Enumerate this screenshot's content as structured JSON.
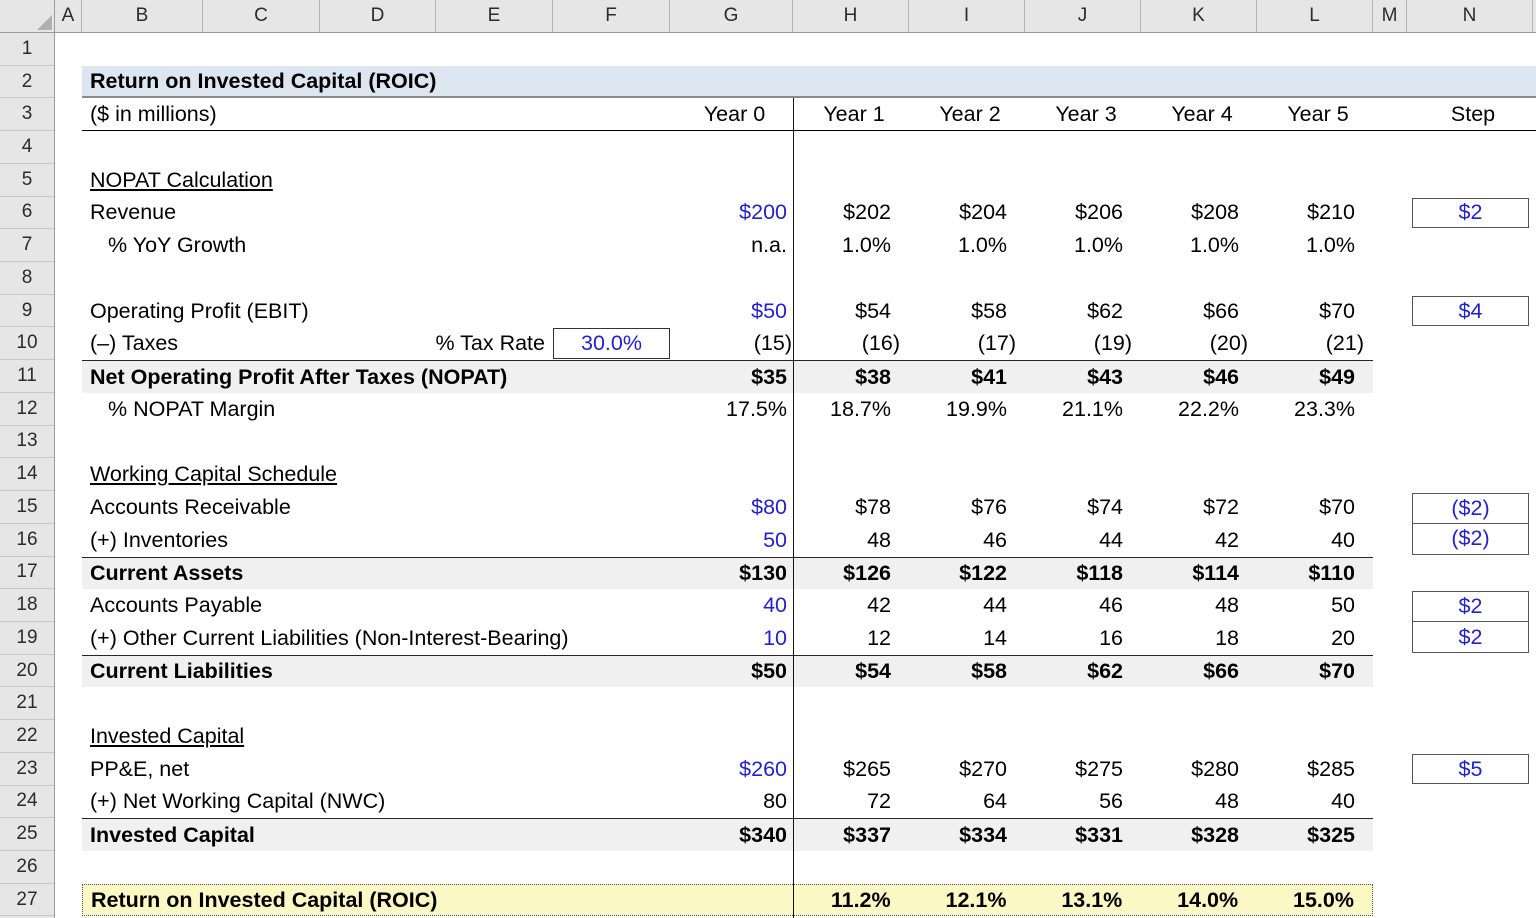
{
  "grid": {
    "column_letters": [
      "A",
      "B",
      "C",
      "D",
      "E",
      "F",
      "G",
      "H",
      "I",
      "J",
      "K",
      "L",
      "M",
      "N"
    ],
    "row_numbers": [
      "1",
      "2",
      "3",
      "4",
      "5",
      "6",
      "7",
      "8",
      "9",
      "10",
      "11",
      "12",
      "13",
      "14",
      "15",
      "16",
      "17",
      "18",
      "19",
      "20",
      "21",
      "22",
      "23",
      "24",
      "25",
      "26",
      "27"
    ]
  },
  "title": {
    "text": "Return on Invested Capital (ROIC)",
    "units": "($ in millions)"
  },
  "headers": {
    "year0": "Year 0",
    "years": [
      "Year 1",
      "Year 2",
      "Year 3",
      "Year 4",
      "Year 5"
    ],
    "step": "Step"
  },
  "colors": {
    "input_text": "#2222CC",
    "title_band_bg": "#DCE6F1",
    "total_band_bg": "#F0F0F0",
    "roic_band_bg": "#FAF9C6"
  },
  "rows": [
    {
      "n": 4,
      "type": "blank"
    },
    {
      "n": 5,
      "type": "section",
      "label": "NOPAT Calculation"
    },
    {
      "n": 6,
      "type": "item",
      "label": "Revenue",
      "y0": "$200",
      "y0_blue": true,
      "years": [
        "$202",
        "$204",
        "$206",
        "$208",
        "$210"
      ],
      "step": "$2"
    },
    {
      "n": 7,
      "type": "item",
      "label": "% YoY Growth",
      "indent": true,
      "y0": "n.a.",
      "years": [
        "1.0%",
        "1.0%",
        "1.0%",
        "1.0%",
        "1.0%"
      ]
    },
    {
      "n": 8,
      "type": "blank"
    },
    {
      "n": 9,
      "type": "item",
      "label": "Operating Profit (EBIT)",
      "y0": "$50",
      "y0_blue": true,
      "years": [
        "$54",
        "$58",
        "$62",
        "$66",
        "$70"
      ],
      "step": "$4"
    },
    {
      "n": 10,
      "type": "taxes",
      "label": "(–) Taxes",
      "tax_label": "% Tax Rate",
      "tax_rate": "30.0%",
      "y0": "(15)",
      "years": [
        "(16)",
        "(17)",
        "(19)",
        "(20)",
        "(21)"
      ]
    },
    {
      "n": 11,
      "type": "total",
      "label": "Net Operating Profit After Taxes (NOPAT)",
      "y0": "$35",
      "years": [
        "$38",
        "$41",
        "$43",
        "$46",
        "$49"
      ]
    },
    {
      "n": 12,
      "type": "item",
      "label": "% NOPAT Margin",
      "indent": true,
      "y0": "17.5%",
      "years": [
        "18.7%",
        "19.9%",
        "21.1%",
        "22.2%",
        "23.3%"
      ]
    },
    {
      "n": 13,
      "type": "blank"
    },
    {
      "n": 14,
      "type": "section",
      "label": "Working Capital Schedule"
    },
    {
      "n": 15,
      "type": "item",
      "label": "Accounts Receivable",
      "y0": "$80",
      "y0_blue": true,
      "years": [
        "$78",
        "$76",
        "$74",
        "$72",
        "$70"
      ],
      "step": "($2)",
      "step_pair": "top"
    },
    {
      "n": 16,
      "type": "item",
      "label": "(+) Inventories",
      "y0": "50",
      "y0_blue": true,
      "years": [
        "48",
        "46",
        "44",
        "42",
        "40"
      ],
      "step": "($2)",
      "step_pair": "bottom"
    },
    {
      "n": 17,
      "type": "total",
      "label": "Current Assets",
      "y0": "$130",
      "years": [
        "$126",
        "$122",
        "$118",
        "$114",
        "$110"
      ]
    },
    {
      "n": 18,
      "type": "item",
      "label": "Accounts Payable",
      "y0": "40",
      "y0_blue": true,
      "years": [
        "42",
        "44",
        "46",
        "48",
        "50"
      ],
      "step": "$2",
      "step_pair": "top"
    },
    {
      "n": 19,
      "type": "item",
      "label": "(+) Other Current Liabilities (Non-Interest-Bearing)",
      "y0": "10",
      "y0_blue": true,
      "years": [
        "12",
        "14",
        "16",
        "18",
        "20"
      ],
      "step": "$2",
      "step_pair": "bottom"
    },
    {
      "n": 20,
      "type": "total",
      "label": "Current Liabilities",
      "y0": "$50",
      "years": [
        "$54",
        "$58",
        "$62",
        "$66",
        "$70"
      ]
    },
    {
      "n": 21,
      "type": "blank"
    },
    {
      "n": 22,
      "type": "section",
      "label": "Invested Capital"
    },
    {
      "n": 23,
      "type": "item",
      "label": "PP&E, net",
      "y0": "$260",
      "y0_blue": true,
      "years": [
        "$265",
        "$270",
        "$275",
        "$280",
        "$285"
      ],
      "step": "$5"
    },
    {
      "n": 24,
      "type": "item",
      "label": "(+) Net Working Capital (NWC)",
      "y0": "80",
      "years": [
        "72",
        "64",
        "56",
        "48",
        "40"
      ]
    },
    {
      "n": 25,
      "type": "total",
      "label": "Invested Capital",
      "y0": "$340",
      "years": [
        "$337",
        "$334",
        "$331",
        "$328",
        "$325"
      ]
    },
    {
      "n": 26,
      "type": "blank"
    },
    {
      "n": 27,
      "type": "roic",
      "label": "Return on Invested Capital (ROIC)",
      "y0": "",
      "years": [
        "11.2%",
        "12.1%",
        "13.1%",
        "14.0%",
        "15.0%"
      ]
    }
  ]
}
